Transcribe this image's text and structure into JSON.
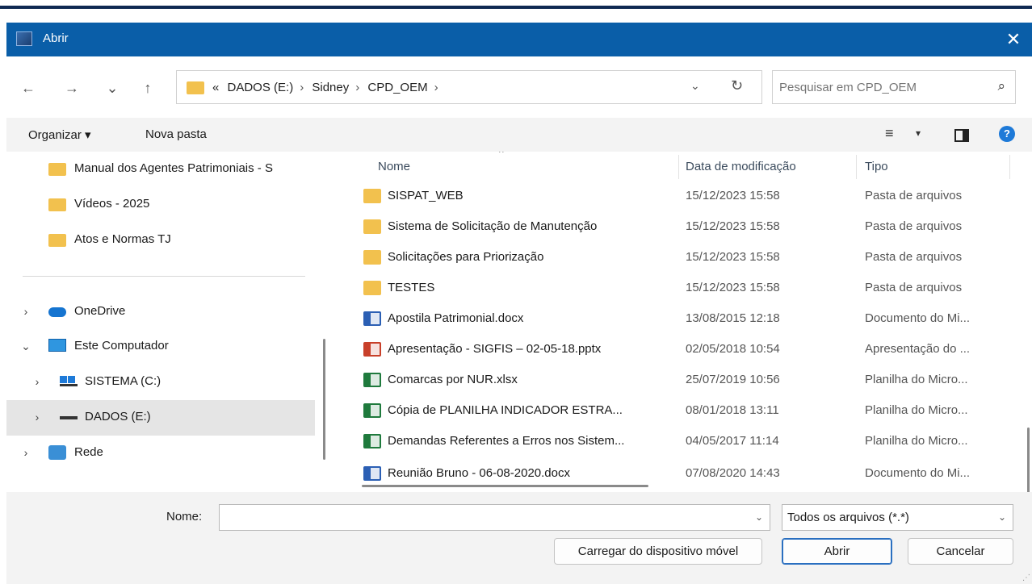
{
  "window": {
    "title": "Abrir",
    "close_glyph": "✕"
  },
  "nav": {
    "back": "←",
    "forward": "→",
    "recent": "⌄",
    "up": "↑"
  },
  "address": {
    "prefix": "«",
    "crumbs": [
      "DADOS (E:)",
      "Sidney",
      "CPD_OEM"
    ],
    "separator": "›",
    "dropdown": "⌄",
    "refresh": "↻"
  },
  "search": {
    "placeholder": "Pesquisar em CPD_OEM",
    "icon": "⌕"
  },
  "toolbar": {
    "organize": "Organizar ▾",
    "new_folder": "Nova pasta",
    "view_icon": "≡",
    "view_caret": "▾",
    "help": "?"
  },
  "tree": {
    "items": [
      {
        "label": "Manual dos Agentes Patrimoniais - S",
        "icon": "folder-icon"
      },
      {
        "label": "Vídeos - 2025",
        "icon": "folder-icon"
      },
      {
        "label": "Atos e Normas TJ",
        "icon": "folder-icon"
      },
      {
        "label": "OneDrive",
        "icon": "onedrive-icon",
        "chevron": "›"
      },
      {
        "label": "Este Computador",
        "icon": "computer-icon",
        "chevron": "⌄"
      },
      {
        "label": "SISTEMA (C:)",
        "icon": "drive-c-icon",
        "chevron": "›"
      },
      {
        "label": "DADOS (E:)",
        "icon": "drive-e-icon",
        "chevron": "›"
      },
      {
        "label": "Rede",
        "icon": "network-icon",
        "chevron": "›"
      }
    ]
  },
  "files": {
    "sort_caret": "^",
    "headers": {
      "name": "Nome",
      "date": "Data de modificação",
      "type": "Tipo"
    },
    "rows": [
      {
        "name": "SISPAT_WEB",
        "date": "15/12/2023 15:58",
        "type": "Pasta de arquivos",
        "kind": "folder"
      },
      {
        "name": "Sistema de Solicitação de Manutenção",
        "date": "15/12/2023 15:58",
        "type": "Pasta de arquivos",
        "kind": "folder"
      },
      {
        "name": "Solicitações para Priorização",
        "date": "15/12/2023 15:58",
        "type": "Pasta de arquivos",
        "kind": "folder"
      },
      {
        "name": "TESTES",
        "date": "15/12/2023 15:58",
        "type": "Pasta de arquivos",
        "kind": "folder"
      },
      {
        "name": "Apostila Patrimonial.docx",
        "date": "13/08/2015 12:18",
        "type": "Documento do Mi...",
        "kind": "word"
      },
      {
        "name": "Apresentação - SIGFIS – 02-05-18.pptx",
        "date": "02/05/2018 10:54",
        "type": "Apresentação do ...",
        "kind": "ppt"
      },
      {
        "name": "Comarcas por NUR.xlsx",
        "date": "25/07/2019 10:56",
        "type": "Planilha do Micro...",
        "kind": "xls"
      },
      {
        "name": "Cópia de PLANILHA  INDICADOR ESTRA...",
        "date": "08/01/2018 13:11",
        "type": "Planilha do Micro...",
        "kind": "xls"
      },
      {
        "name": "Demandas Referentes a Erros nos Sistem...",
        "date": "04/05/2017 11:14",
        "type": "Planilha do Micro...",
        "kind": "xls"
      },
      {
        "name": "Reunião Bruno - 06-08-2020.docx",
        "date": "07/08/2020 14:43",
        "type": "Documento do Mi...",
        "kind": "word"
      }
    ]
  },
  "footer": {
    "name_label": "Nome:",
    "name_value": "",
    "dropdown": "⌄",
    "filter": "Todos os arquivos (*.*)",
    "mobile_button": "Carregar do dispositivo móvel",
    "open_button": "Abrir",
    "cancel_button": "Cancelar",
    "grip": "⋰"
  },
  "colors": {
    "titlebar": "#0a5ea8",
    "accent": "#1e7ad8",
    "folder": "#f2c14e",
    "selected": "#e5e5e5"
  }
}
